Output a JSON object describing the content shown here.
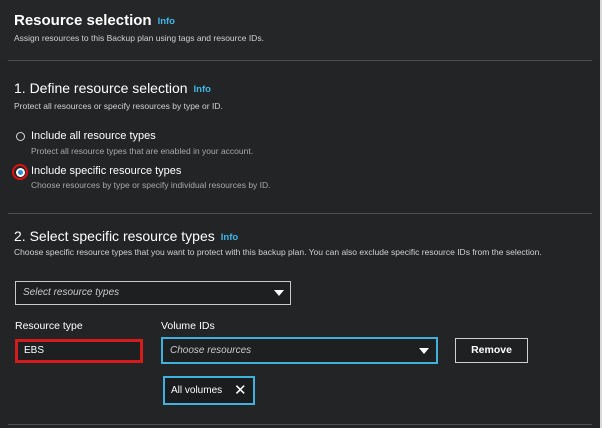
{
  "header": {
    "title": "Resource selection",
    "info": "Info",
    "subtitle": "Assign resources to this Backup plan using tags and resource IDs."
  },
  "section1": {
    "title": "1. Define resource selection",
    "info": "Info",
    "subtitle": "Protect all resources or specify resources by type or ID.",
    "options": [
      {
        "label": "Include all resource types",
        "description": "Protect all resource types that are enabled in your account.",
        "selected": false
      },
      {
        "label": "Include specific resource types",
        "description": "Choose resources by type or specify individual resources by ID.",
        "selected": true
      }
    ]
  },
  "section2": {
    "title": "2. Select specific resource types",
    "info": "Info",
    "subtitle": "Choose specific resource types that you want to protect with this backup plan. You can also exclude specific resource IDs from the selection.",
    "type_select_placeholder": "Select resource types",
    "resource_type_label": "Resource type",
    "resource_type_value": "EBS",
    "volume_ids_label": "Volume IDs",
    "volume_select_placeholder": "Choose resources",
    "remove_label": "Remove",
    "token_label": "All volumes",
    "token_remove": "✕"
  },
  "colors": {
    "accent": "#3fb6e6",
    "highlight": "#e01010",
    "focus_border": "#3fb1dc"
  }
}
